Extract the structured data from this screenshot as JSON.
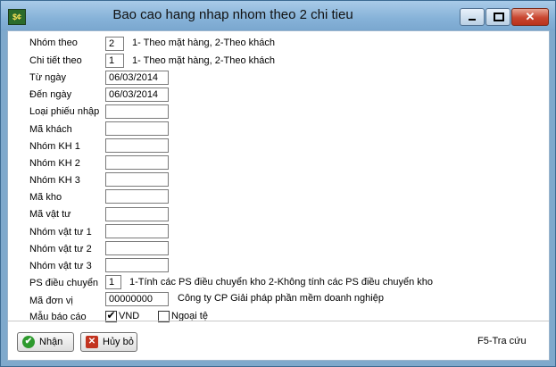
{
  "window": {
    "title": "Bao cao hang nhap nhom theo 2 chi tieu",
    "app_icon": "$¢"
  },
  "title_buttons": {
    "close": "✕"
  },
  "form": {
    "nhom_theo": {
      "label": "Nhóm theo",
      "value": "2",
      "hint": "1- Theo mặt hàng, 2-Theo khách"
    },
    "chi_tiet_theo": {
      "label": "Chi tiết theo",
      "value": "1",
      "hint": "1- Theo mặt hàng, 2-Theo khách"
    },
    "tu_ngay": {
      "label": "Từ ngày",
      "value": "06/03/2014"
    },
    "den_ngay": {
      "label": "Đến ngày",
      "value": "06/03/2014"
    },
    "loai_phieu_nhap": {
      "label": "Loại phiếu nhập",
      "value": ""
    },
    "ma_khach": {
      "label": "Mã khách",
      "value": ""
    },
    "nhom_kh_1": {
      "label": "Nhóm KH 1",
      "value": ""
    },
    "nhom_kh_2": {
      "label": "Nhóm KH 2",
      "value": ""
    },
    "nhom_kh_3": {
      "label": "Nhóm KH 3",
      "value": ""
    },
    "ma_kho": {
      "label": "Mã kho",
      "value": ""
    },
    "ma_vat_tu": {
      "label": "Mã vật tư",
      "value": ""
    },
    "nhom_vat_tu_1": {
      "label": "Nhóm vật tư 1",
      "value": ""
    },
    "nhom_vat_tu_2": {
      "label": "Nhóm vật tư 2",
      "value": ""
    },
    "nhom_vat_tu_3": {
      "label": "Nhóm vật tư 3",
      "value": ""
    },
    "ps_dieu_chuyen": {
      "label": "PS điều chuyển",
      "value": "1",
      "hint": "1-Tính các PS điều chuyển kho 2-Không tính các PS điều chuyển kho"
    },
    "ma_don_vi": {
      "label": "Mã đơn vị",
      "value": "00000000",
      "hint": "Công ty CP Giải pháp phần mềm doanh nghiệp"
    },
    "mau_bao_cao": {
      "label": "Mẫu báo cáo",
      "vnd_label": "VND",
      "vnd_checked": true,
      "ngoai_te_label": "Ngoại tệ",
      "ngoai_te_checked": false,
      "check_glyph": "✔"
    }
  },
  "buttons": {
    "ok": {
      "label": "Nhận",
      "icon_glyph": "✔"
    },
    "cancel": {
      "label": "Hủy bỏ",
      "icon_glyph": "✕"
    }
  },
  "footer": {
    "hint": "F5-Tra cứu"
  },
  "colors": {
    "ok_icon": "#2e9a2e",
    "cancel_icon": "#c2331f"
  }
}
